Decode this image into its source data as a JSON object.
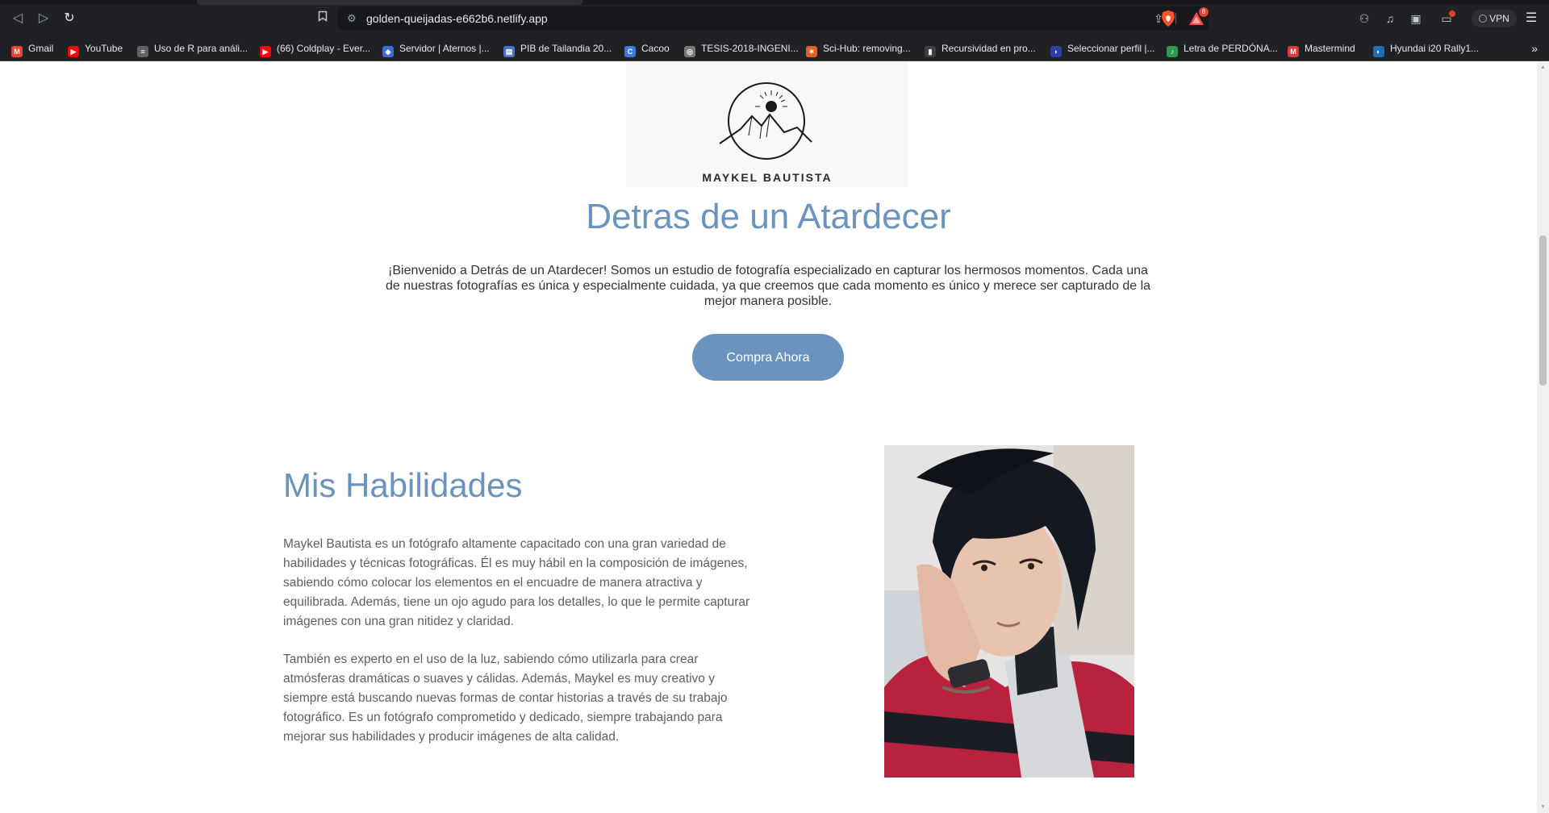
{
  "browser": {
    "url": "golden-queijadas-e662b6.netlify.app",
    "rewards_badge": "8",
    "vpn_label": "VPN",
    "bookmarks": [
      {
        "label": "Gmail",
        "icon": "gmail-icon",
        "color": "#ea4335",
        "glyph": "M"
      },
      {
        "label": "YouTube",
        "icon": "youtube-icon",
        "color": "#ff0000",
        "glyph": "▶"
      },
      {
        "label": "Uso de R para análi...",
        "icon": "document-icon",
        "color": "#5f6368",
        "glyph": "≡"
      },
      {
        "label": "(66) Coldplay - Ever...",
        "icon": "youtube-icon",
        "color": "#ff0000",
        "glyph": "▶"
      },
      {
        "label": "Servidor | Aternos |...",
        "icon": "aternos-icon",
        "color": "#3a6fd8",
        "glyph": "◆"
      },
      {
        "label": "PIB de Tailandia 20...",
        "icon": "chart-icon",
        "color": "#4a73c9",
        "glyph": "▤"
      },
      {
        "label": "Cacoo",
        "icon": "cacoo-icon",
        "color": "#3d7be0",
        "glyph": "C"
      },
      {
        "label": "TESIS-2018-INGENI...",
        "icon": "globe-icon",
        "color": "#7a7a7a",
        "glyph": "◎"
      },
      {
        "label": "Sci-Hub: removing...",
        "icon": "scihub-icon",
        "color": "#d9622b",
        "glyph": "✶"
      },
      {
        "label": "Recursividad en pro...",
        "icon": "bookmark-page-icon",
        "color": "#3c4043",
        "glyph": "▮"
      },
      {
        "label": "Seleccionar perfil |...",
        "icon": "profile-icon",
        "color": "#2b3ea8",
        "glyph": "◗"
      },
      {
        "label": "Letra de PERDÓNA...",
        "icon": "lyrics-icon",
        "color": "#2f9a4d",
        "glyph": "♪"
      },
      {
        "label": "Mastermind",
        "icon": "mastermind-icon",
        "color": "#d93b3b",
        "glyph": "M"
      },
      {
        "label": "Hyundai i20 Rally1...",
        "icon": "hyundai-icon",
        "color": "#1f6fb2",
        "glyph": "◐"
      }
    ]
  },
  "page": {
    "logo_text": "MAYKEL BAUTISTA",
    "hero_title": "Detras de un Atardecer",
    "hero_text": "¡Bienvenido a Detrás de un Atardecer! Somos un estudio de fotografía especializado en capturar los hermosos momentos. Cada una de nuestras fotografías es única y especialmente cuidada, ya que creemos que cada momento es único y merece ser capturado de la mejor manera posible.",
    "cta_label": "Compra Ahora",
    "skills_title": "Mis Habilidades",
    "skills_p1": "Maykel Bautista es un fotógrafo altamente capacitado con una gran variedad de habilidades y técnicas fotográficas. Él es muy hábil en la composición de imágenes, sabiendo cómo colocar los elementos en el encuadre de manera atractiva y equilibrada. Además, tiene un ojo agudo para los detalles, lo que le permite capturar imágenes con una gran nitidez y claridad.",
    "skills_p2": "También es experto en el uso de la luz, sabiendo cómo utilizarla para crear atmósferas dramáticas o suaves y cálidas. Además, Maykel es muy creativo y siempre está buscando nuevas formas de contar historias a través de su trabajo fotográfico. Es un fotógrafo comprometido y dedicado, siempre trabajando para mejorar sus habilidades y producir imágenes de alta calidad.",
    "accent_color": "#6a93bd"
  }
}
